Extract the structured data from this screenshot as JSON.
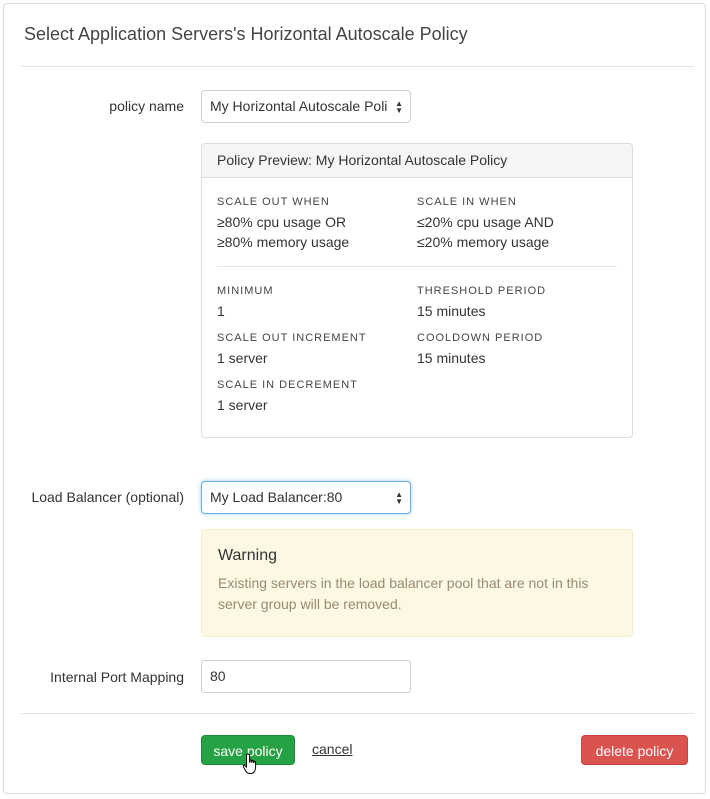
{
  "dialog": {
    "title": "Select Application Servers's Horizontal Autoscale Policy"
  },
  "policy": {
    "label": "policy name",
    "selected": "My Horizontal Autoscale Poli"
  },
  "preview": {
    "header": "Policy Preview: My Horizontal Autoscale Policy",
    "scale_out_when_label": "SCALE OUT WHEN",
    "scale_out_line1": "≥80% cpu usage OR",
    "scale_out_line2": "≥80% memory usage",
    "scale_in_when_label": "SCALE IN WHEN",
    "scale_in_line1": "≤20% cpu usage AND",
    "scale_in_line2": "≤20% memory usage",
    "minimum_label": "MINIMUM",
    "minimum_value": "1",
    "threshold_label": "THRESHOLD PERIOD",
    "threshold_value": "15 minutes",
    "scale_out_inc_label": "SCALE OUT INCREMENT",
    "scale_out_inc_value": "1 server",
    "cooldown_label": "COOLDOWN PERIOD",
    "cooldown_value": "15 minutes",
    "scale_in_dec_label": "SCALE IN DECREMENT",
    "scale_in_dec_value": "1 server"
  },
  "load_balancer": {
    "label": "Load Balancer (optional)",
    "selected": "My Load Balancer:80"
  },
  "warning": {
    "title": "Warning",
    "body": "Existing servers in the load balancer pool that are not in this server group will be removed."
  },
  "port_mapping": {
    "label": "Internal Port Mapping",
    "value": "80"
  },
  "actions": {
    "save_label": "save policy",
    "cancel_label": "cancel",
    "delete_label": "delete policy"
  },
  "colors": {
    "save": "#25a244",
    "delete": "#d9534f",
    "warning_bg": "#fcf8e3",
    "focus": "#66afe9"
  },
  "icons": {
    "select_arrows": "up-down-arrows-icon",
    "cursor": "hand-pointer-icon"
  }
}
